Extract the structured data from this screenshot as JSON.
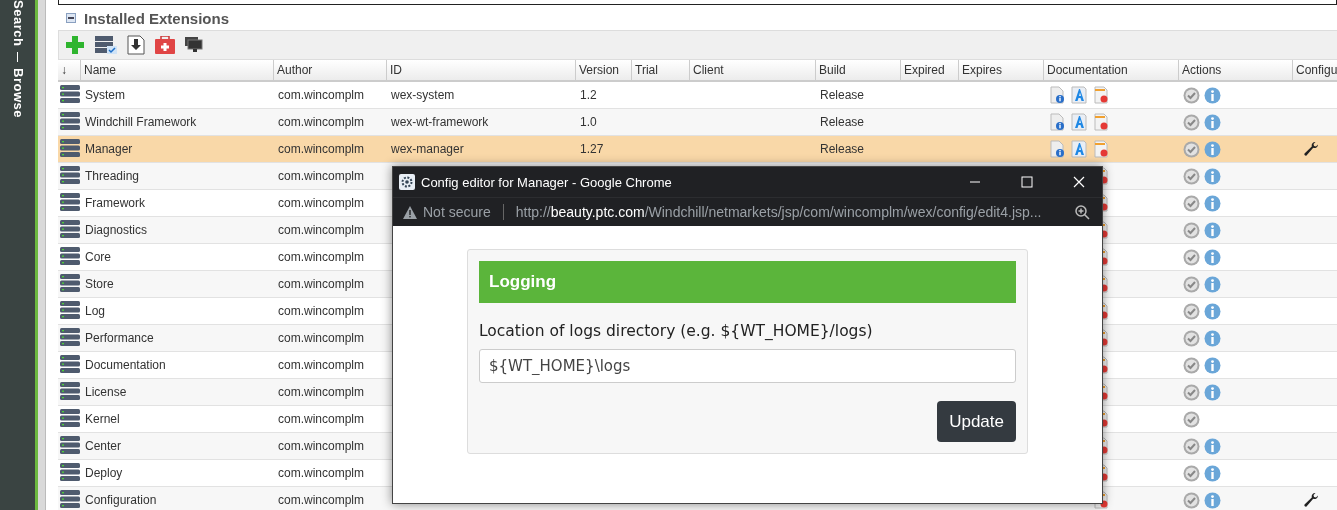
{
  "sidebar": {
    "links": [
      {
        "label": "Search"
      },
      {
        "label": "Browse"
      }
    ]
  },
  "section": {
    "title": "Installed Extensions",
    "expanded": true
  },
  "table": {
    "sort_indicator": "↓",
    "columns": [
      "Name",
      "Author",
      "ID",
      "Version",
      "Trial",
      "Client",
      "Build",
      "Expired",
      "Expires",
      "Documentation",
      "Actions",
      "Configu"
    ],
    "rows": [
      {
        "name": "System",
        "author": "com.wincomplm",
        "id": "wex-system",
        "version": "1.2",
        "build": "Release",
        "selected": false,
        "info": true,
        "configurable": false
      },
      {
        "name": "Windchill Framework",
        "author": "com.wincomplm",
        "id": "wex-wt-framework",
        "version": "1.0",
        "build": "Release",
        "selected": false,
        "info": true,
        "configurable": false
      },
      {
        "name": "Manager",
        "author": "com.wincomplm",
        "id": "wex-manager",
        "version": "1.27",
        "build": "Release",
        "selected": true,
        "info": true,
        "configurable": true
      },
      {
        "name": "Threading",
        "author": "com.wincomplm",
        "selected": false,
        "info": true,
        "configurable": false
      },
      {
        "name": "Framework",
        "author": "com.wincomplm",
        "selected": false,
        "info": true,
        "configurable": false
      },
      {
        "name": "Diagnostics",
        "author": "com.wincomplm",
        "selected": false,
        "info": true,
        "configurable": false
      },
      {
        "name": "Core",
        "author": "com.wincomplm",
        "selected": false,
        "info": true,
        "configurable": false
      },
      {
        "name": "Store",
        "author": "com.wincomplm",
        "selected": false,
        "info": true,
        "configurable": false
      },
      {
        "name": "Log",
        "author": "com.wincomplm",
        "selected": false,
        "info": true,
        "configurable": false
      },
      {
        "name": "Performance",
        "author": "com.wincomplm",
        "selected": false,
        "info": true,
        "configurable": false
      },
      {
        "name": "Documentation",
        "author": "com.wincomplm",
        "selected": false,
        "info": true,
        "configurable": false
      },
      {
        "name": "License",
        "author": "com.wincomplm",
        "selected": false,
        "info": true,
        "configurable": false
      },
      {
        "name": "Kernel",
        "author": "com.wincomplm",
        "selected": false,
        "info": false,
        "configurable": false
      },
      {
        "name": "Center",
        "author": "com.wincomplm",
        "selected": false,
        "info": true,
        "configurable": false
      },
      {
        "name": "Deploy",
        "author": "com.wincomplm",
        "selected": false,
        "info": true,
        "configurable": false
      },
      {
        "name": "Configuration",
        "author": "com.wincomplm",
        "selected": false,
        "info": true,
        "configurable": true
      }
    ]
  },
  "popup": {
    "title": "Config editor for Manager - Google Chrome",
    "security": "Not secure",
    "url": {
      "scheme": "http://",
      "host": "beauty.ptc.com",
      "path": "/Windchill/netmarkets/jsp/com/wincomplm/wex/config/edit4.jsp..."
    },
    "panel": {
      "heading": "Logging",
      "label": "Location of logs directory (e.g. ${WT_HOME}/logs)",
      "value": "${WT_HOME}\\logs",
      "button": "Update"
    }
  }
}
